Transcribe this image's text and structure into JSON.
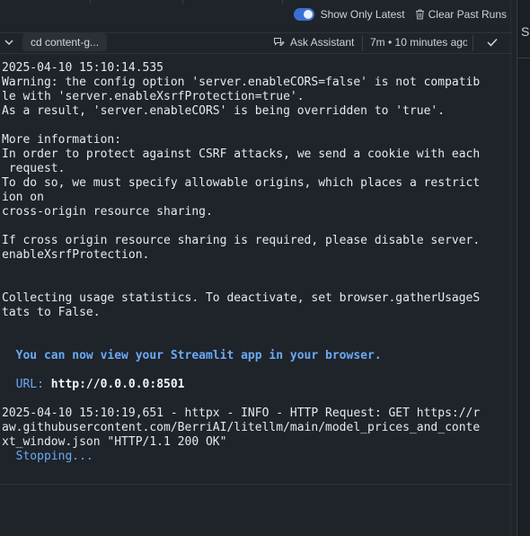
{
  "header": {
    "toggle_label": "Show Only Latest",
    "toggle_on": true,
    "clear_label": "Clear Past Runs"
  },
  "cmdbar": {
    "command": "cd content-g...",
    "ask_label": "Ask Assistant",
    "time_label": "7m • 10 minutes ago"
  },
  "console": {
    "lines": [
      "2025-04-10 15:10:14.535",
      "Warning: the config option 'server.enableCORS=false' is not compatib",
      "le with 'server.enableXsrfProtection=true'.",
      "As a result, 'server.enableCORS' is being overridden to 'true'.",
      "",
      "More information:",
      "In order to protect against CSRF attacks, we send a cookie with each",
      " request.",
      "To do so, we must specify allowable origins, which places a restrict",
      "ion on",
      "cross-origin resource sharing.",
      "",
      "If cross origin resource sharing is required, please disable server.",
      "enableXsrfProtection.",
      "",
      "",
      "Collecting usage statistics. To deactivate, set browser.gatherUsageS",
      "tats to False.",
      "",
      ""
    ],
    "streamlit_msg": "  You can now view your Streamlit app in your browser.",
    "url_label": "  URL: ",
    "url_value": "http://0.0.0.0:8501",
    "httpx_lines": [
      "2025-04-10 15:10:19,651 - httpx - INFO - HTTP Request: GET https://r",
      "aw.githubusercontent.com/BerriAI/litellm/main/model_prices_and_conte",
      "xt_window.json \"HTTP/1.1 200 OK\""
    ],
    "stopping": "  Stopping..."
  },
  "right_panel": {
    "letter": "S"
  },
  "colors": {
    "background": "#1f232a",
    "accent_blue": "#6aaaf4",
    "toggle_blue": "#3b6fd6"
  }
}
